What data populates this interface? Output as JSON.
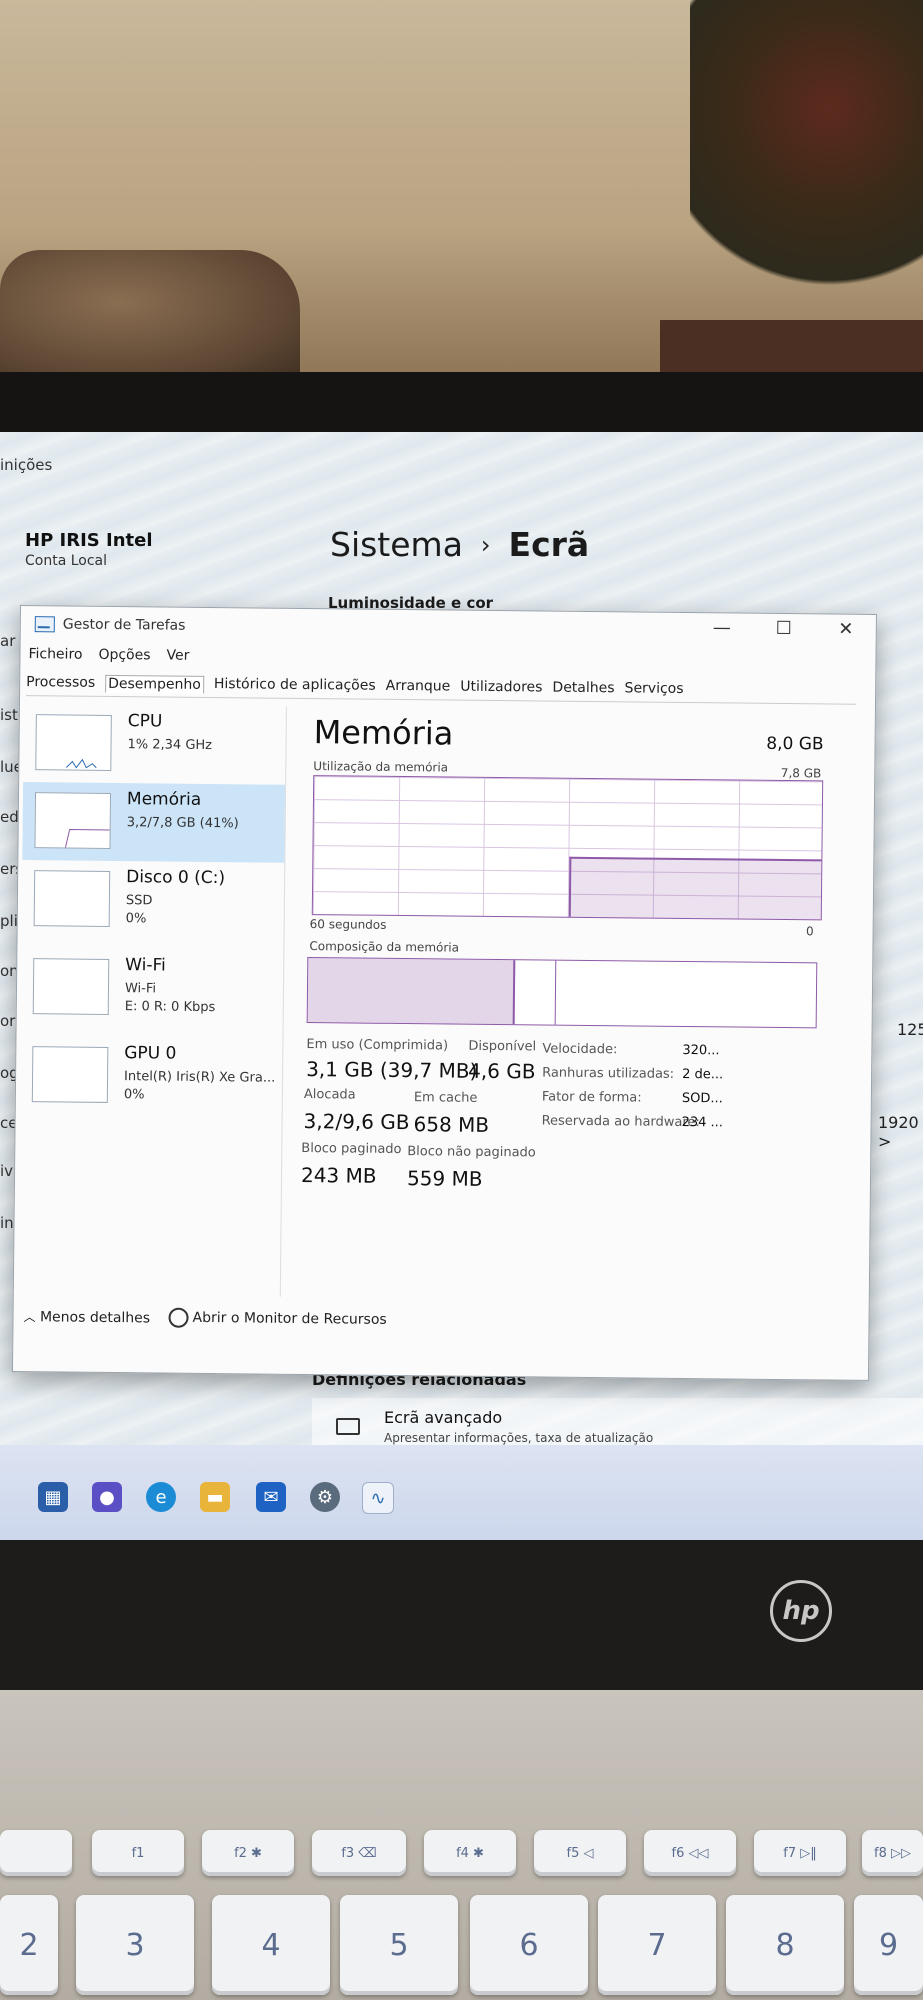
{
  "settings": {
    "header": "inições",
    "user_name": "HP IRIS Intel",
    "user_sub": "Conta Local",
    "breadcrumb_parent": "Sistema",
    "breadcrumb_sep": "›",
    "breadcrumb_current": "Ecrã",
    "section_title": "Luminosidade e cor",
    "side_fragments": [
      "ar u",
      "iste",
      "lue",
      "ede",
      "ers",
      "plic",
      "ont",
      "ora",
      "ogo",
      "ces",
      "iva",
      "inc"
    ],
    "resolution_a": "125",
    "resolution_b": "1920 >",
    "related_title": "Definições relacionadas",
    "advanced_label": "Ecrã avançado",
    "advanced_sub": "Apresentar informações, taxa de atualização"
  },
  "task_manager": {
    "title": "Gestor de Tarefas",
    "window_buttons": [
      "—",
      "☐",
      "✕"
    ],
    "menu": [
      "Ficheiro",
      "Opções",
      "Ver"
    ],
    "tabs": [
      "Processos",
      "Desempenho",
      "Histórico de aplicações",
      "Arranque",
      "Utilizadores",
      "Detalhes",
      "Serviços"
    ],
    "active_tab": "Desempenho",
    "perf_items": [
      {
        "name": "CPU",
        "line1": "1% 2,34 GHz",
        "line2": ""
      },
      {
        "name": "Memória",
        "line1": "3,2/7,8 GB (41%)",
        "line2": ""
      },
      {
        "name": "Disco 0 (C:)",
        "line1": "SSD",
        "line2": "0%"
      },
      {
        "name": "Wi-Fi",
        "line1": "Wi-Fi",
        "line2": "E: 0 R: 0 Kbps"
      },
      {
        "name": "GPU 0",
        "line1": "Intel(R) Iris(R) Xe Gra...",
        "line2": "0%"
      }
    ],
    "memory": {
      "title": "Memória",
      "total": "8,0 GB",
      "usage_label": "Utilização da memória",
      "usage_max": "7,8 GB",
      "time_label": "60 segundos",
      "time_zero": "0",
      "composition_label": "Composição da memória",
      "in_use_label": "Em uso (Comprimida)",
      "in_use_value": "3,1 GB (39,7 MB)",
      "available_label": "Disponível",
      "available_value": "4,6 GB",
      "committed_label": "Alocada",
      "committed_value": "3,2/9,6 GB",
      "cached_label": "Em cache",
      "cached_value": "658 MB",
      "paged_label": "Bloco paginado",
      "paged_value": "243 MB",
      "nonpaged_label": "Bloco não paginado",
      "nonpaged_value": "559 MB",
      "specs": [
        {
          "label": "Velocidade:",
          "value": "320..."
        },
        {
          "label": "Ranhuras utilizadas:",
          "value": "2 de..."
        },
        {
          "label": "Fator de forma:",
          "value": "SOD..."
        },
        {
          "label": "Reservada ao hardware:",
          "value": "234 ..."
        }
      ]
    },
    "footer_less": "Menos detalhes",
    "footer_monitor": "Abrir o Monitor de Recursos"
  },
  "keyboard": {
    "row1": [
      "",
      "f1",
      "f2 ✱",
      "f3 ⌫",
      "f4 ✱",
      "f5 ◁",
      "f6 ◁◁",
      "f7 ▷‖",
      "f8 ▷▷"
    ],
    "row2": [
      "2",
      "3",
      "4",
      "5",
      "6",
      "7",
      "8",
      "9"
    ]
  },
  "laptop_brand": "hp",
  "colors": {
    "memory_accent": "#8e5aa8",
    "selected_item": "#cce4f7"
  }
}
